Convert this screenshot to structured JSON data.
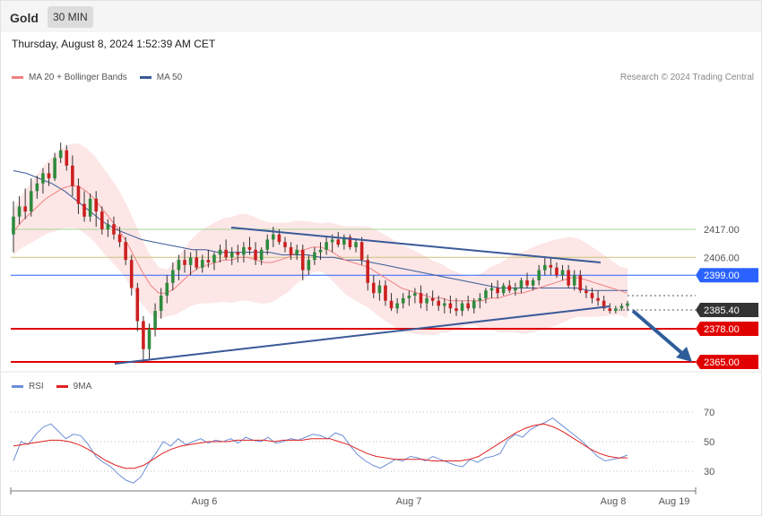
{
  "header": {
    "title": "Gold",
    "timeframe": "30 MIN",
    "datetime": "Thursday, August 8, 2024 1:52:39 AM CET"
  },
  "legend": {
    "main": [
      {
        "label": "MA 20 + Bollinger Bands",
        "color": "#f08080"
      },
      {
        "label": "MA 50",
        "color": "#3a5a98"
      }
    ],
    "rsi": [
      {
        "label": "RSI",
        "color": "#6b8fd8"
      },
      {
        "label": "9MA",
        "color": "#e02020"
      }
    ]
  },
  "copyright": "Research © 2024 Trading Central",
  "chart_data": {
    "type": "candlestick",
    "instrument": "Gold",
    "interval": "30 MIN",
    "x_labels": [
      "Aug 6",
      "Aug 7",
      "Aug 8",
      "Aug 19"
    ],
    "price_levels": [
      {
        "value": 2417.0,
        "label": "2417.00",
        "kind": "resistance"
      },
      {
        "value": 2406.0,
        "label": "2406.00",
        "kind": "resistance"
      },
      {
        "value": 2399.0,
        "label": "2399.00",
        "kind": "pivot"
      },
      {
        "value": 2385.4,
        "label": "2385.40",
        "kind": "last"
      },
      {
        "value": 2378.0,
        "label": "2378.00",
        "kind": "support"
      },
      {
        "value": 2365.0,
        "label": "2365.00",
        "kind": "support"
      }
    ],
    "ohlc": [
      [
        2415,
        2428,
        2408,
        2422
      ],
      [
        2422,
        2430,
        2419,
        2426
      ],
      [
        2426,
        2433,
        2421,
        2424
      ],
      [
        2424,
        2437,
        2422,
        2432
      ],
      [
        2432,
        2438,
        2429,
        2435
      ],
      [
        2435,
        2441,
        2431,
        2439
      ],
      [
        2439,
        2443,
        2434,
        2437
      ],
      [
        2437,
        2447,
        2436,
        2445
      ],
      [
        2445,
        2451,
        2443,
        2448
      ],
      [
        2448,
        2450,
        2440,
        2442
      ],
      [
        2442,
        2446,
        2430,
        2434
      ],
      [
        2434,
        2437,
        2423,
        2427
      ],
      [
        2427,
        2432,
        2420,
        2422
      ],
      [
        2422,
        2431,
        2420,
        2429
      ],
      [
        2429,
        2432,
        2418,
        2424
      ],
      [
        2424,
        2426,
        2415,
        2417
      ],
      [
        2417,
        2421,
        2414,
        2419
      ],
      [
        2419,
        2422,
        2413,
        2415
      ],
      [
        2415,
        2418,
        2410,
        2412
      ],
      [
        2412,
        2414,
        2403,
        2405
      ],
      [
        2405,
        2407,
        2391,
        2394
      ],
      [
        2394,
        2396,
        2377,
        2381
      ],
      [
        2381,
        2383,
        2365,
        2370
      ],
      [
        2370,
        2380,
        2366,
        2378
      ],
      [
        2378,
        2388,
        2375,
        2385
      ],
      [
        2385,
        2394,
        2382,
        2391
      ],
      [
        2391,
        2399,
        2388,
        2396
      ],
      [
        2396,
        2404,
        2393,
        2401
      ],
      [
        2401,
        2407,
        2397,
        2405
      ],
      [
        2405,
        2409,
        2400,
        2403
      ],
      [
        2403,
        2408,
        2399,
        2406
      ],
      [
        2406,
        2409,
        2401,
        2402
      ],
      [
        2402,
        2407,
        2400,
        2405
      ],
      [
        2405,
        2409,
        2402,
        2404
      ],
      [
        2404,
        2408,
        2401,
        2407
      ],
      [
        2407,
        2411,
        2404,
        2409
      ],
      [
        2409,
        2413,
        2405,
        2406
      ],
      [
        2406,
        2410,
        2403,
        2408
      ],
      [
        2408,
        2411,
        2404,
        2407
      ],
      [
        2407,
        2412,
        2404,
        2410
      ],
      [
        2410,
        2414,
        2407,
        2409
      ],
      [
        2409,
        2412,
        2403,
        2405
      ],
      [
        2405,
        2410,
        2403,
        2409
      ],
      [
        2409,
        2415,
        2407,
        2413
      ],
      [
        2413,
        2418,
        2410,
        2415
      ],
      [
        2415,
        2417,
        2411,
        2412
      ],
      [
        2412,
        2414,
        2408,
        2410
      ],
      [
        2410,
        2412,
        2405,
        2407
      ],
      [
        2407,
        2411,
        2405,
        2409
      ],
      [
        2409,
        2411,
        2397,
        2401
      ],
      [
        2401,
        2407,
        2399,
        2405
      ],
      [
        2405,
        2410,
        2403,
        2408
      ],
      [
        2408,
        2412,
        2405,
        2409
      ],
      [
        2409,
        2414,
        2407,
        2412
      ],
      [
        2412,
        2415,
        2408,
        2413
      ],
      [
        2413,
        2416,
        2410,
        2411
      ],
      [
        2411,
        2415,
        2409,
        2414
      ],
      [
        2414,
        2415,
        2409,
        2410
      ],
      [
        2410,
        2413,
        2408,
        2412
      ],
      [
        2412,
        2414,
        2403,
        2405
      ],
      [
        2405,
        2407,
        2393,
        2396
      ],
      [
        2396,
        2399,
        2390,
        2392
      ],
      [
        2392,
        2397,
        2389,
        2395
      ],
      [
        2395,
        2397,
        2387,
        2389
      ],
      [
        2389,
        2392,
        2385,
        2386
      ],
      [
        2386,
        2390,
        2384,
        2388
      ],
      [
        2388,
        2392,
        2386,
        2390
      ],
      [
        2390,
        2393,
        2387,
        2391
      ],
      [
        2391,
        2394,
        2388,
        2392
      ],
      [
        2392,
        2395,
        2386,
        2388
      ],
      [
        2388,
        2392,
        2385,
        2390
      ],
      [
        2390,
        2393,
        2387,
        2389
      ],
      [
        2389,
        2391,
        2385,
        2387
      ],
      [
        2387,
        2390,
        2384,
        2388
      ],
      [
        2388,
        2391,
        2384,
        2386
      ],
      [
        2386,
        2390,
        2383,
        2385
      ],
      [
        2385,
        2389,
        2383,
        2388
      ],
      [
        2388,
        2391,
        2385,
        2386
      ],
      [
        2386,
        2390,
        2384,
        2389
      ],
      [
        2389,
        2392,
        2386,
        2390
      ],
      [
        2390,
        2394,
        2388,
        2393
      ],
      [
        2393,
        2396,
        2390,
        2394
      ],
      [
        2394,
        2397,
        2390,
        2392
      ],
      [
        2392,
        2396,
        2391,
        2395
      ],
      [
        2395,
        2397,
        2392,
        2393
      ],
      [
        2393,
        2396,
        2391,
        2394
      ],
      [
        2394,
        2398,
        2392,
        2397
      ],
      [
        2397,
        2400,
        2394,
        2395
      ],
      [
        2395,
        2398,
        2393,
        2397
      ],
      [
        2397,
        2403,
        2395,
        2401
      ],
      [
        2401,
        2406,
        2399,
        2403
      ],
      [
        2403,
        2406,
        2399,
        2402
      ],
      [
        2402,
        2404,
        2398,
        2399
      ],
      [
        2399,
        2403,
        2397,
        2401
      ],
      [
        2401,
        2403,
        2394,
        2395
      ],
      [
        2395,
        2401,
        2393,
        2399
      ],
      [
        2399,
        2401,
        2392,
        2393
      ],
      [
        2393,
        2395,
        2390,
        2392
      ],
      [
        2392,
        2394,
        2388,
        2390
      ],
      [
        2390,
        2393,
        2387,
        2389
      ],
      [
        2389,
        2391,
        2385,
        2386
      ],
      [
        2386,
        2388,
        2384,
        2385
      ],
      [
        2385,
        2387,
        2384,
        2386
      ],
      [
        2386,
        2388,
        2385,
        2387
      ],
      [
        2387,
        2389,
        2385,
        2388
      ]
    ],
    "ma20": [
      2416,
      2420,
      2423,
      2426,
      2429,
      2431,
      2433,
      2434,
      2434,
      2432,
      2429,
      2425,
      2421,
      2417,
      2412,
      2406,
      2400,
      2395,
      2392,
      2392,
      2394,
      2397,
      2400,
      2402,
      2403,
      2404,
      2405,
      2405,
      2406,
      2406,
      2405,
      2404,
      2404,
      2405,
      2406,
      2408,
      2409,
      2410,
      2410,
      2409,
      2407,
      2405,
      2404,
      2403,
      2402,
      2400,
      2398,
      2396,
      2394,
      2393,
      2392,
      2391,
      2390,
      2390,
      2389,
      2389,
      2389,
      2389,
      2389,
      2390,
      2390,
      2391,
      2392,
      2392,
      2393,
      2394,
      2395,
      2396,
      2397,
      2398,
      2398,
      2397,
      2396,
      2395,
      2394,
      2393,
      2392
    ],
    "ma50": [
      2440,
      2439,
      2437,
      2435,
      2432,
      2428,
      2424,
      2420,
      2417,
      2415,
      2413,
      2412,
      2411,
      2410,
      2409,
      2409,
      2408,
      2408,
      2408,
      2408,
      2408,
      2407,
      2407,
      2407,
      2406,
      2406,
      2405,
      2405,
      2404,
      2403,
      2402,
      2401,
      2400,
      2399,
      2398,
      2397,
      2396,
      2395,
      2394,
      2394,
      2394,
      2394,
      2394,
      2394,
      2394,
      2393,
      2393,
      2393,
      2393
    ],
    "rsi": [
      37,
      50,
      48,
      55,
      60,
      62,
      57,
      52,
      55,
      54,
      48,
      40,
      36,
      33,
      28,
      24,
      22,
      26,
      35,
      42,
      50,
      47,
      52,
      48,
      50,
      52,
      49,
      51,
      50,
      52,
      49,
      53,
      51,
      50,
      53,
      49,
      50,
      52,
      51,
      53,
      55,
      54,
      52,
      56,
      54,
      47,
      41,
      37,
      34,
      32,
      35,
      38,
      37,
      40,
      39,
      37,
      40,
      38,
      36,
      34,
      33,
      38,
      36,
      39,
      40,
      42,
      51,
      55,
      53,
      58,
      61,
      63,
      66,
      62,
      58,
      54,
      50,
      45,
      40,
      37,
      38,
      39,
      41
    ],
    "rsi_ma": [
      47,
      48,
      49,
      50,
      51,
      51,
      50,
      48,
      45,
      41,
      37,
      34,
      32,
      32,
      34,
      38,
      42,
      45,
      47,
      48,
      49,
      50,
      50,
      50,
      51,
      51,
      51,
      51,
      50,
      51,
      51,
      51,
      52,
      52,
      52,
      50,
      48,
      45,
      42,
      40,
      39,
      38,
      38,
      38,
      38,
      37,
      37,
      37,
      37,
      38,
      40,
      44,
      48,
      52,
      56,
      59,
      61,
      62,
      60,
      57,
      53,
      49,
      45,
      42,
      40,
      39,
      39
    ],
    "rsi_levels": [
      70,
      50,
      30
    ]
  }
}
